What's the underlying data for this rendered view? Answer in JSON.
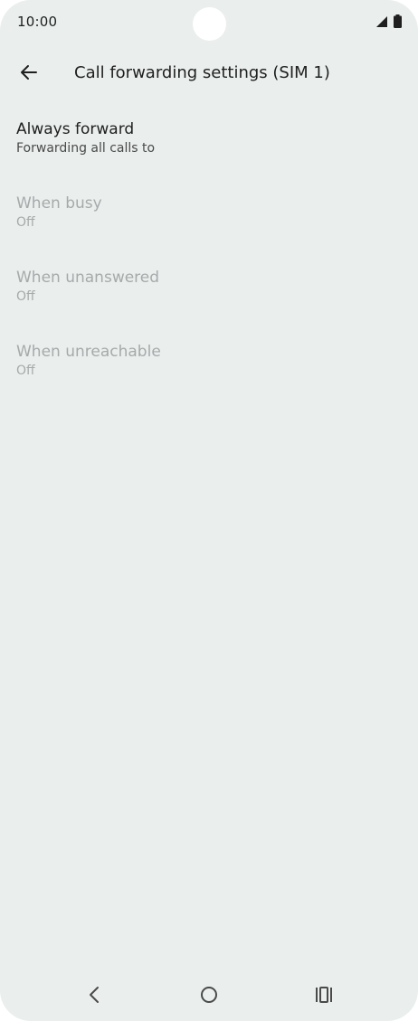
{
  "status": {
    "time": "10:00",
    "icons": [
      "signal-icon",
      "battery-icon"
    ]
  },
  "header": {
    "back_icon": "arrow-left-icon",
    "title": "Call forwarding settings (SIM 1)"
  },
  "items": [
    {
      "title": "Always forward",
      "subtitle": "Forwarding all calls to",
      "enabled": true
    },
    {
      "title": "When busy",
      "subtitle": "Off",
      "enabled": false
    },
    {
      "title": "When unanswered",
      "subtitle": "Off",
      "enabled": false
    },
    {
      "title": "When unreachable",
      "subtitle": "Off",
      "enabled": false
    }
  ],
  "nav": {
    "back_icon": "nav-back-icon",
    "home_icon": "nav-home-icon",
    "recents_icon": "nav-recents-icon"
  },
  "colors": {
    "background": "#eaeeed",
    "text_primary": "#1f1f1f",
    "text_disabled": "#a7aaaa"
  }
}
